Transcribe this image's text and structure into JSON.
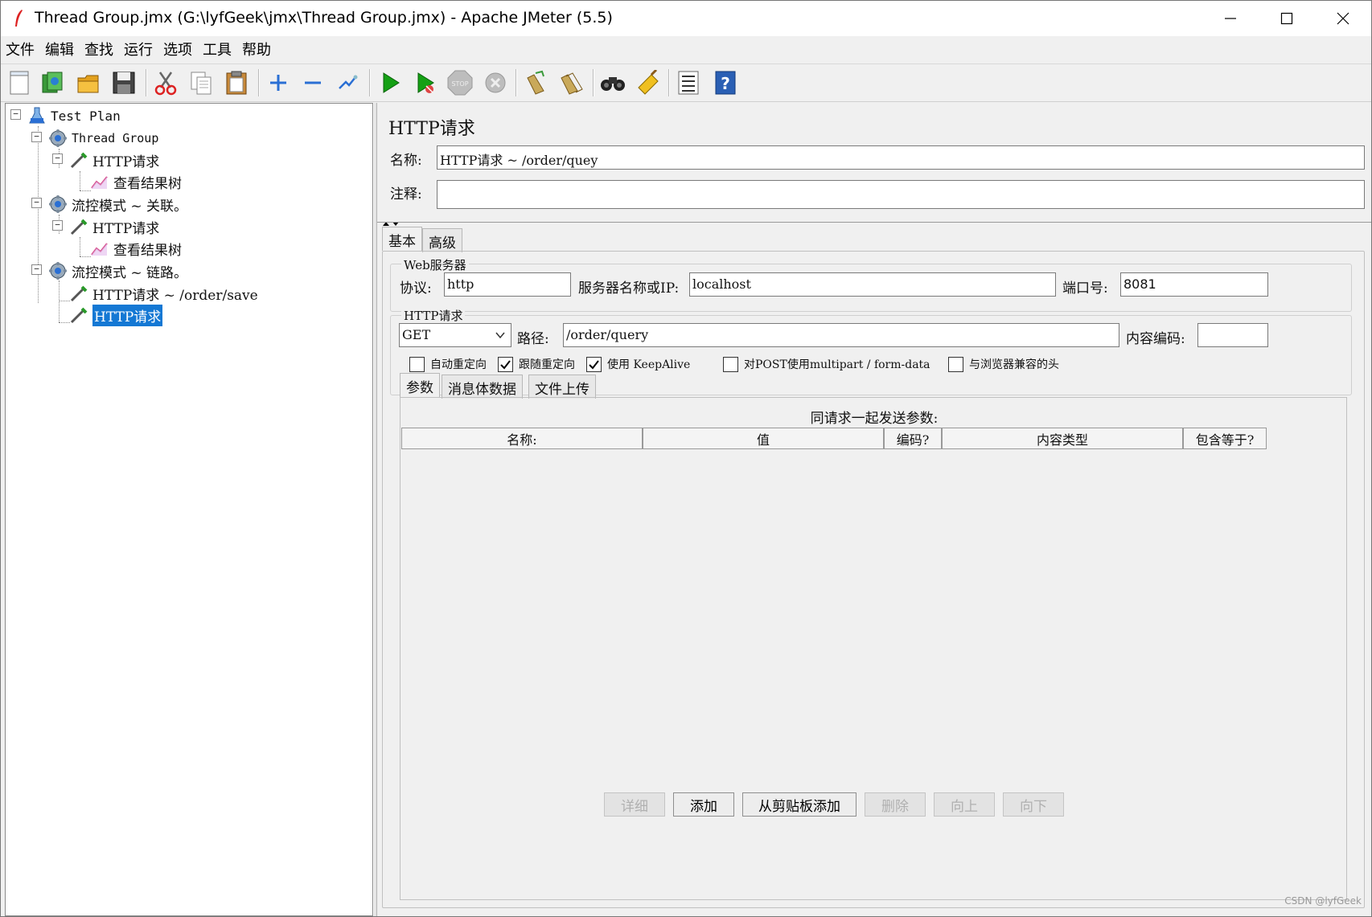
{
  "window": {
    "title": "Thread Group.jmx (G:\\lyfGeek\\jmx\\Thread Group.jmx) - Apache JMeter (5.5)",
    "minimize_icon": "minimize-icon",
    "maximize_icon": "maximize-icon",
    "close_icon": "close-icon"
  },
  "menu": [
    "文件",
    "编辑",
    "查找",
    "运行",
    "选项",
    "工具",
    "帮助"
  ],
  "toolbar": {
    "icons": [
      "new-icon",
      "templates-icon",
      "open-icon",
      "save-icon",
      "cut-icon",
      "copy-icon",
      "paste-icon",
      "expand-icon",
      "collapse-icon",
      "toggle-icon",
      "start-icon",
      "start-no-pause-icon",
      "stop-icon",
      "shutdown-icon",
      "clear-icon",
      "clear-all-icon",
      "search-icon",
      "reset-search-icon",
      "function-helper-icon",
      "help-icon"
    ]
  },
  "tree": {
    "nodes": [
      {
        "label": "Test Plan",
        "icon": "test-plan-icon"
      },
      {
        "label": "Thread Group",
        "icon": "thread-group-icon"
      },
      {
        "label": "HTTP请求",
        "icon": "sampler-icon"
      },
      {
        "label": "查看结果树",
        "icon": "listener-icon"
      },
      {
        "label": "流控模式 ~ 关联。",
        "icon": "thread-group-icon"
      },
      {
        "label": "HTTP请求",
        "icon": "sampler-icon"
      },
      {
        "label": "查看结果树",
        "icon": "listener-icon"
      },
      {
        "label": "流控模式 ~ 链路。",
        "icon": "thread-group-icon"
      },
      {
        "label": "HTTP请求 ~ /order/save",
        "icon": "sampler-icon"
      },
      {
        "label": "HTTP请求",
        "icon": "sampler-icon",
        "selected": true
      }
    ]
  },
  "editor": {
    "heading": "HTTP请求",
    "name_label": "名称:",
    "name_value": "HTTP请求 ~ /order/quey",
    "comment_label": "注释:",
    "comment_value": "",
    "tabs": [
      "基本",
      "高级"
    ],
    "web_server": {
      "group_title": "Web服务器",
      "protocol_label": "协议:",
      "protocol_value": "http",
      "server_label": "服务器名称或IP:",
      "server_value": "localhost",
      "port_label": "端口号:",
      "port_value": "8081"
    },
    "http_request": {
      "group_title": "HTTP请求",
      "method_value": "GET",
      "path_label": "路径:",
      "path_value": "/order/query",
      "encoding_label": "内容编码:",
      "encoding_value": ""
    },
    "checkboxes": [
      {
        "label": "自动重定向",
        "checked": false
      },
      {
        "label": "跟随重定向",
        "checked": true
      },
      {
        "label": "使用 KeepAlive",
        "checked": true
      },
      {
        "label": "对POST使用multipart / form-data",
        "checked": false
      },
      {
        "label": "与浏览器兼容的头",
        "checked": false
      }
    ],
    "sub_tabs": [
      "参数",
      "消息体数据",
      "文件上传"
    ],
    "params_caption": "同请求一起发送参数:",
    "columns": [
      "名称:",
      "值",
      "编码?",
      "内容类型",
      "包含等于?"
    ],
    "buttons": [
      {
        "label": "详细",
        "enabled": false
      },
      {
        "label": "添加",
        "enabled": true
      },
      {
        "label": "从剪贴板添加",
        "enabled": true
      },
      {
        "label": "删除",
        "enabled": false
      },
      {
        "label": "向上",
        "enabled": false
      },
      {
        "label": "向下",
        "enabled": false
      }
    ]
  },
  "watermark": "CSDN @lyfGeek",
  "colors": {
    "selection": "#1478d4",
    "run_green": "#14a014"
  }
}
